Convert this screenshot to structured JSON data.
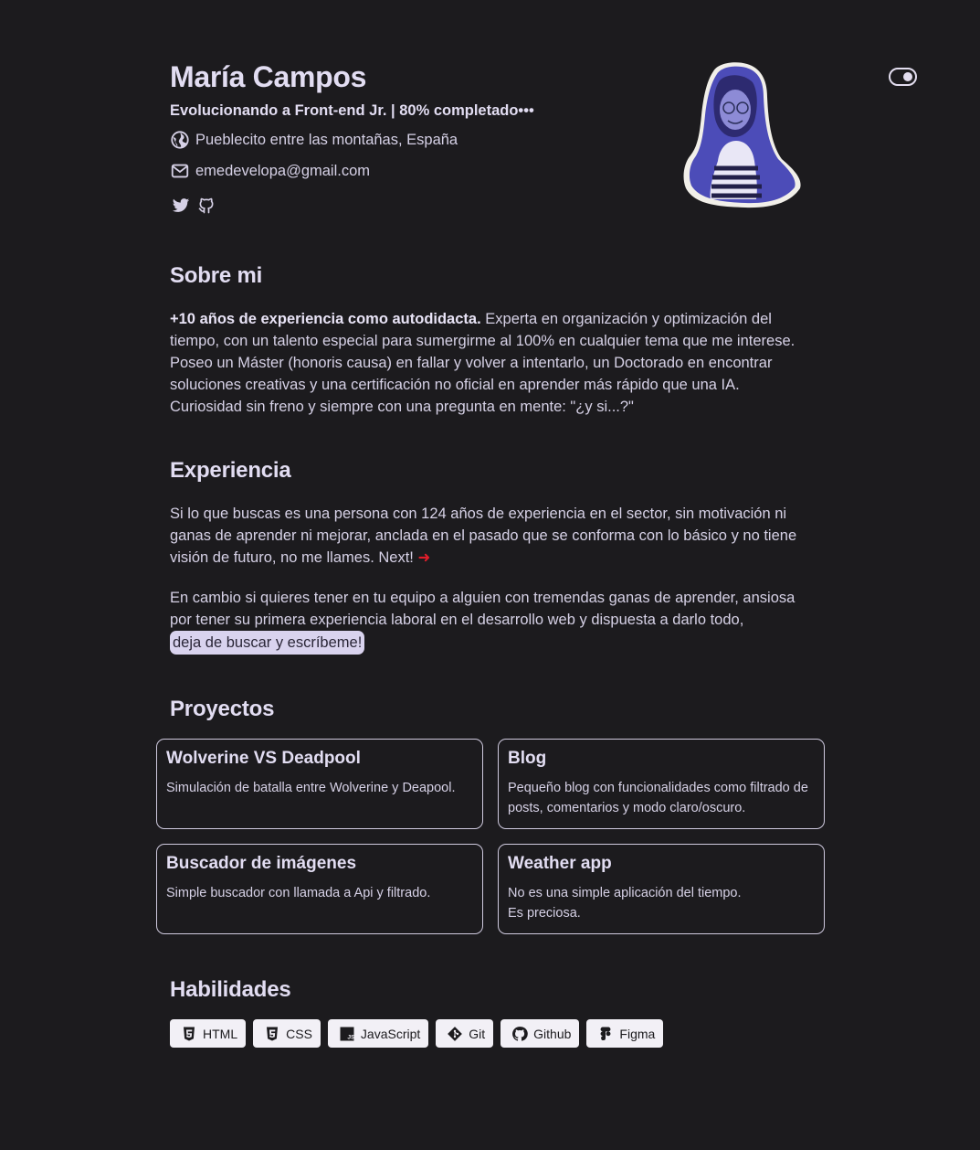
{
  "header": {
    "name": "María Campos",
    "tagline": "Evolucionando a Front-end Jr. | 80% completado•••",
    "location": "Pueblecito entre las montañas, España",
    "email": "emedevelopa@gmail.com",
    "social": [
      "twitter-icon",
      "github-icon"
    ]
  },
  "about": {
    "title": "Sobre mi",
    "bold": "+10 años de experiencia como autodidacta.",
    "text": " Experta en organización y optimización del tiempo, con un talento especial para sumergirme al 100% en cualquier tema que me interese. Poseo un Máster (honoris causa) en fallar y volver a intentarlo, un Doctorado en encontrar soluciones creativas y una certificación no oficial en aprender más rápido que una IA. Curiosidad sin freno y siempre con una pregunta en mente: \"¿y si...?\""
  },
  "experience": {
    "title": "Experiencia",
    "p1": "Si lo que buscas es una persona con 124 años de experiencia en el sector, sin motivación ni ganas de aprender ni mejorar, anclada en el pasado que se conforma con lo básico y no tiene visión de futuro, no me llames. Next! ",
    "arrow": "➜",
    "p2": "En cambio si quieres tener en tu equipo a alguien con tremendas ganas de aprender, ansiosa por tener su primera experiencia laboral en el desarrollo web y dispuesta a darlo todo, ",
    "cta": "deja de buscar y escríbeme!"
  },
  "projects": {
    "title": "Proyectos",
    "items": [
      {
        "title": "Wolverine VS Deadpool",
        "desc": "Simulación de batalla entre Wolverine y Deapool."
      },
      {
        "title": "Blog",
        "desc": "Pequeño blog con funcionalidades como filtrado de posts, comentarios y modo claro/oscuro."
      },
      {
        "title": "Buscador de imágenes",
        "desc": "Simple buscador con llamada a Api y filtrado."
      },
      {
        "title": "Weather app",
        "desc": "No es una simple aplicación del tiempo.\nEs preciosa."
      }
    ]
  },
  "skills": {
    "title": "Habilidades",
    "items": [
      "HTML",
      "CSS",
      "JavaScript",
      "Git",
      "Github",
      "Figma"
    ]
  },
  "colors": {
    "background": "#1c1b1e",
    "text": "#dcd7ee",
    "accent_arrow": "#e11d2a",
    "avatar_tint": "#5b5cc9"
  }
}
